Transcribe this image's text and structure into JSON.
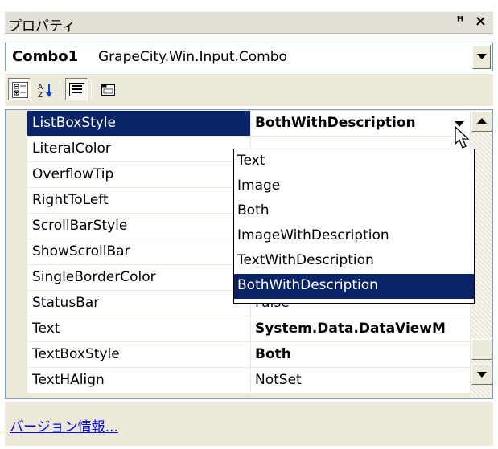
{
  "window": {
    "title": "プロパティ"
  },
  "selector": {
    "object_name": "Combo1",
    "object_type": "GrapeCity.Win.Input.Combo"
  },
  "toolbar": {
    "buttons": [
      "categorized-icon",
      "alphabetical-icon",
      "properties-icon",
      "property-pages-icon"
    ]
  },
  "grid": {
    "rows": [
      {
        "name": "ListBoxStyle",
        "value": "BothWithDescription"
      },
      {
        "name": "LiteralColor",
        "value": ""
      },
      {
        "name": "OverflowTip",
        "value": ""
      },
      {
        "name": "RightToLeft",
        "value": ""
      },
      {
        "name": "ScrollBarStyle",
        "value": ""
      },
      {
        "name": "ShowScrollBar",
        "value": ""
      },
      {
        "name": "SingleBorderColor",
        "value": ""
      },
      {
        "name": "StatusBar",
        "value": "False"
      },
      {
        "name": "Text",
        "value": "System.Data.DataViewM"
      },
      {
        "name": "TextBoxStyle",
        "value": "Both"
      },
      {
        "name": "TextHAlign",
        "value": "NotSet"
      }
    ]
  },
  "dropdown": {
    "options": [
      "Text",
      "Image",
      "Both",
      "ImageWithDescription",
      "TextWithDescription",
      "BothWithDescription"
    ],
    "selected": "BothWithDescription"
  },
  "footer": {
    "link_text": "バージョン情報..."
  },
  "colors": {
    "selection": "#0a246a",
    "link": "#0000ff",
    "panel": "#ece9d8"
  }
}
